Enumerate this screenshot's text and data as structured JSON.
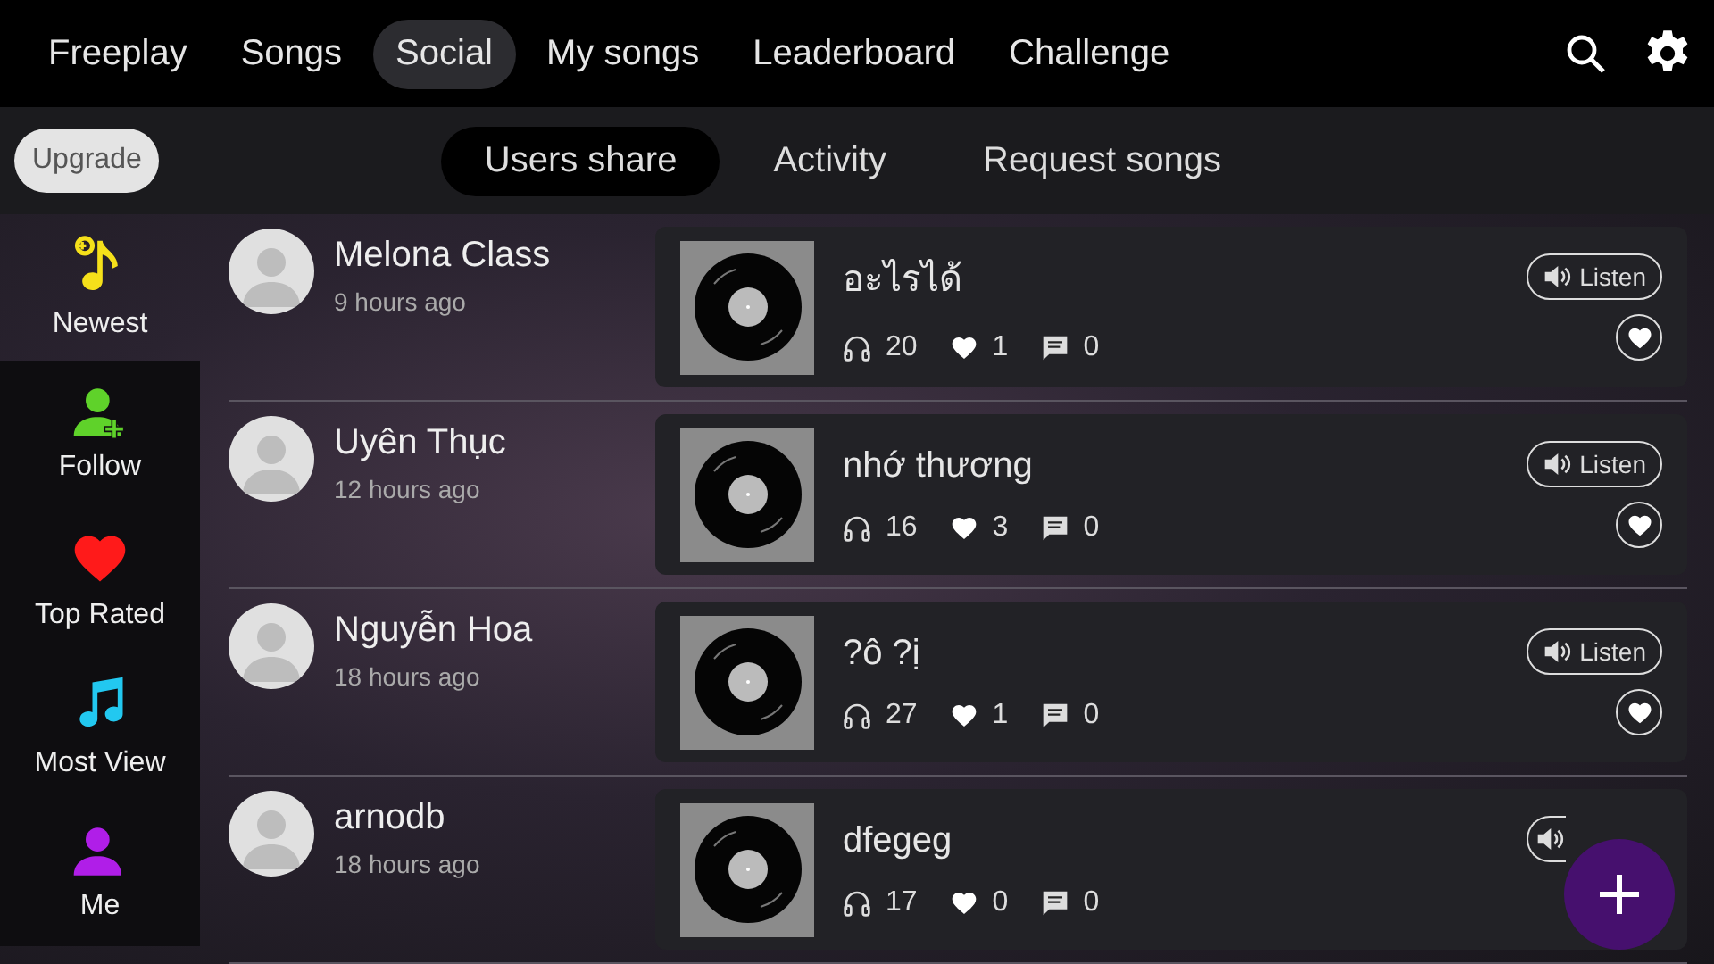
{
  "tabs": [
    {
      "label": "Freeplay",
      "selected": false
    },
    {
      "label": "Songs",
      "selected": false
    },
    {
      "label": "Social",
      "selected": true
    },
    {
      "label": "My songs",
      "selected": false
    },
    {
      "label": "Leaderboard",
      "selected": false
    },
    {
      "label": "Challenge",
      "selected": false
    }
  ],
  "upgrade": "Upgrade",
  "subtabs": [
    {
      "label": "Users share",
      "selected": true
    },
    {
      "label": "Activity",
      "selected": false
    },
    {
      "label": "Request songs",
      "selected": false
    }
  ],
  "sidebar": [
    {
      "label": "Newest",
      "kind": "newest",
      "selected": true,
      "color": "#f5e01a"
    },
    {
      "label": "Follow",
      "kind": "follow",
      "selected": false,
      "color": "#5fd22a"
    },
    {
      "label": "Top Rated",
      "kind": "heart",
      "selected": false,
      "color": "#ff1a1a"
    },
    {
      "label": "Most View",
      "kind": "music",
      "selected": false,
      "color": "#22c8f0"
    },
    {
      "label": "Me",
      "kind": "user",
      "selected": false,
      "color": "#b01ee8"
    }
  ],
  "posts": [
    {
      "user": "Melona Class",
      "time": "9 hours ago",
      "song": "อะไรได้",
      "listens": "20",
      "likes": "1",
      "comments": "0",
      "listen": "Listen"
    },
    {
      "user": "Uyên Thục",
      "time": "12 hours ago",
      "song": "nhớ thương",
      "listens": "16",
      "likes": "3",
      "comments": "0",
      "listen": "Listen"
    },
    {
      "user": "Nguyễn Hoa",
      "time": "18 hours ago",
      "song": "?ô ?ị",
      "listens": "27",
      "likes": "1",
      "comments": "0",
      "listen": "Listen"
    },
    {
      "user": "arnodb",
      "time": "18 hours ago",
      "song": "dfegeg",
      "listens": "17",
      "likes": "0",
      "comments": "0"
    }
  ]
}
